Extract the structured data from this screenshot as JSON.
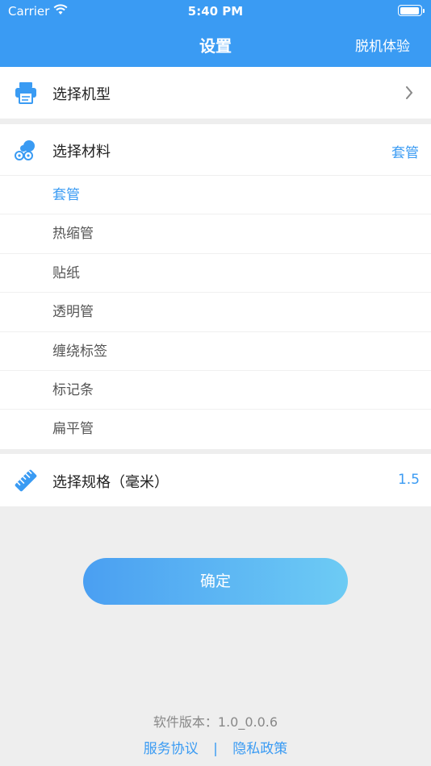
{
  "status_bar": {
    "carrier": "Carrier",
    "time": "5:40 PM"
  },
  "nav": {
    "title": "设置",
    "right_action": "脱机体验"
  },
  "model_row": {
    "label": "选择机型"
  },
  "material_row": {
    "label": "选择材料",
    "selected_value": "套管",
    "options": [
      "套管",
      "热缩管",
      "贴纸",
      "透明管",
      "缠绕标签",
      "标记条",
      "扁平管"
    ]
  },
  "spec_row": {
    "label": "选择规格（毫米）",
    "value": "1.5"
  },
  "confirm_button": {
    "label": "确定"
  },
  "footer": {
    "version": "软件版本：1.0_0.0.6",
    "service_link": "服务协议",
    "separator": "|",
    "privacy_link": "隐私政策"
  },
  "colors": {
    "accent": "#3a9bf3",
    "background": "#eeeeee"
  },
  "icons": {
    "model": "printer-icon",
    "material": "material-rolls-icon",
    "spec": "ruler-icon",
    "chevron": "chevron-right-icon"
  }
}
